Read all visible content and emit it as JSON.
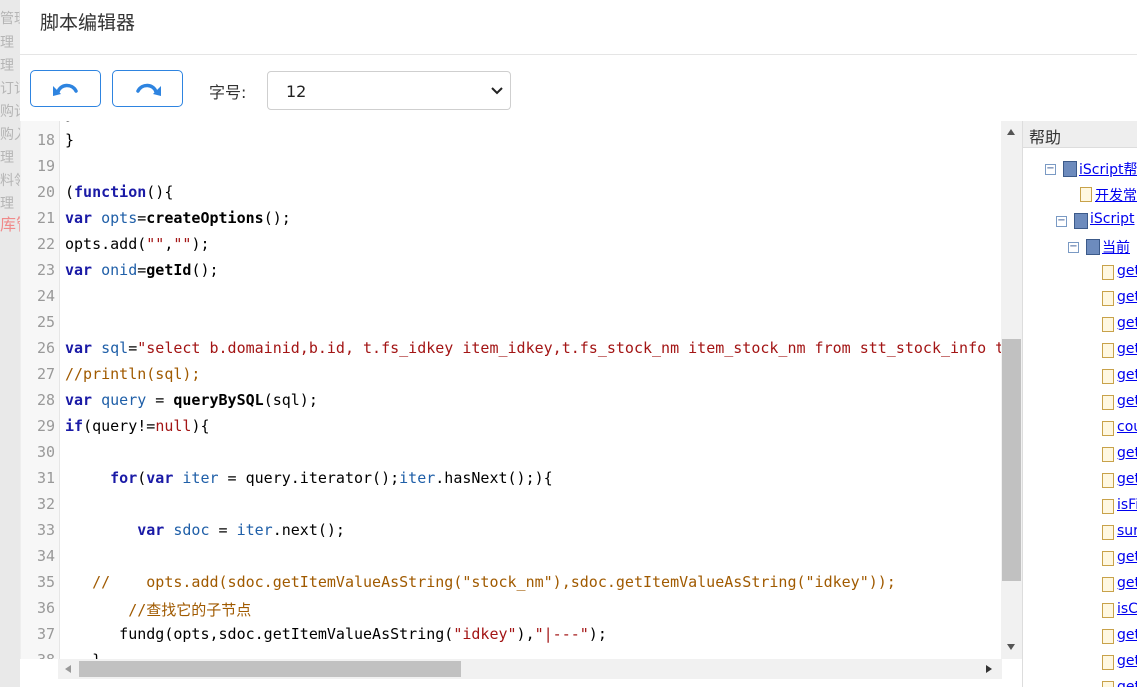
{
  "background_menu": [
    "管理",
    "理",
    "理",
    "订记",
    "购计",
    "购入",
    "理",
    "料领",
    "理",
    "库管"
  ],
  "dialog": {
    "title": "脚本编辑器"
  },
  "toolbar": {
    "undo_icon": "undo-icon",
    "redo_icon": "redo-icon",
    "font_size_label": "字号:",
    "font_size_value": "12"
  },
  "editor": {
    "lines": [
      {
        "n": "",
        "html": "}"
      },
      {
        "n": "18",
        "html": "}"
      },
      {
        "n": "19",
        "html": ""
      },
      {
        "n": "20",
        "html": "(<span class='kw'>function</span>(){"
      },
      {
        "n": "21",
        "html": "<span class='kw'>var</span> <span class='vr'>opts</span>=<b>createOptions</b>();"
      },
      {
        "n": "22",
        "html": "opts.add(<span class='st'>\"\"</span>,<span class='st'>\"\"</span>);"
      },
      {
        "n": "23",
        "html": "<span class='kw'>var</span> <span class='vr'>onid</span>=<b>getId</b>();"
      },
      {
        "n": "24",
        "html": ""
      },
      {
        "n": "25",
        "html": ""
      },
      {
        "n": "26",
        "html": "<span class='kw'>var</span> <span class='vr'>sql</span>=<span class='st'>\"select b.domainid,b.id, t.fs_idkey item_idkey,t.fs_stock_nm item_stock_nm from stt_stock_info t</span>"
      },
      {
        "n": "27",
        "html": "<span class='cm'>//println(sql);</span>"
      },
      {
        "n": "28",
        "html": "<span class='kw'>var</span> <span class='vr'>query</span> = <b>queryBySQL</b>(sql);"
      },
      {
        "n": "29",
        "html": "<span class='kw'>if</span>(query!=<span class='st'>null</span>){"
      },
      {
        "n": "30",
        "html": ""
      },
      {
        "n": "31",
        "html": "     <span class='kw'>for</span>(<span class='kw'>var</span> <span class='vr'>iter</span> = query.iterator();<span class='vr'>iter</span>.hasNext();){"
      },
      {
        "n": "32",
        "html": ""
      },
      {
        "n": "33",
        "html": "        <span class='kw'>var</span> <span class='vr'>sdoc</span> = <span class='vr'>iter</span>.next();"
      },
      {
        "n": "34",
        "html": ""
      },
      {
        "n": "35",
        "html": "   <span class='cm'>//    opts.add(sdoc.getItemValueAsString(\"stock_nm\"),sdoc.getItemValueAsString(\"idkey\"));</span>"
      },
      {
        "n": "36",
        "html": "       <span class='cm'>//查找它的子节点</span>"
      },
      {
        "n": "37",
        "html": "      fundg(opts,sdoc.getItemValueAsString(<span class='st'>\"idkey\"</span>),<span class='st'>\"|---\"</span>);"
      },
      {
        "n": "38",
        "html": "   }"
      }
    ]
  },
  "help": {
    "title": "帮助",
    "nodes": [
      {
        "label": "iScript帮",
        "type": "book",
        "toggle": "⊟"
      },
      {
        "label": "开发常",
        "type": "doc"
      },
      {
        "label": "iScript",
        "type": "book",
        "toggle": "⊟"
      },
      {
        "label": "当前",
        "type": "book",
        "toggle": "⊟"
      },
      {
        "label": "get",
        "type": "doc"
      },
      {
        "label": "get",
        "type": "doc"
      },
      {
        "label": "get",
        "type": "doc"
      },
      {
        "label": "get",
        "type": "doc"
      },
      {
        "label": "get",
        "type": "doc"
      },
      {
        "label": "get",
        "type": "doc"
      },
      {
        "label": "cou",
        "type": "doc"
      },
      {
        "label": "get",
        "type": "doc"
      },
      {
        "label": "get",
        "type": "doc"
      },
      {
        "label": "isFi",
        "type": "doc"
      },
      {
        "label": "sur",
        "type": "doc"
      },
      {
        "label": "get",
        "type": "doc"
      },
      {
        "label": "get",
        "type": "doc"
      },
      {
        "label": "isC",
        "type": "doc"
      },
      {
        "label": "get",
        "type": "doc"
      },
      {
        "label": "get",
        "type": "doc"
      },
      {
        "label": "get",
        "type": "doc"
      }
    ]
  }
}
